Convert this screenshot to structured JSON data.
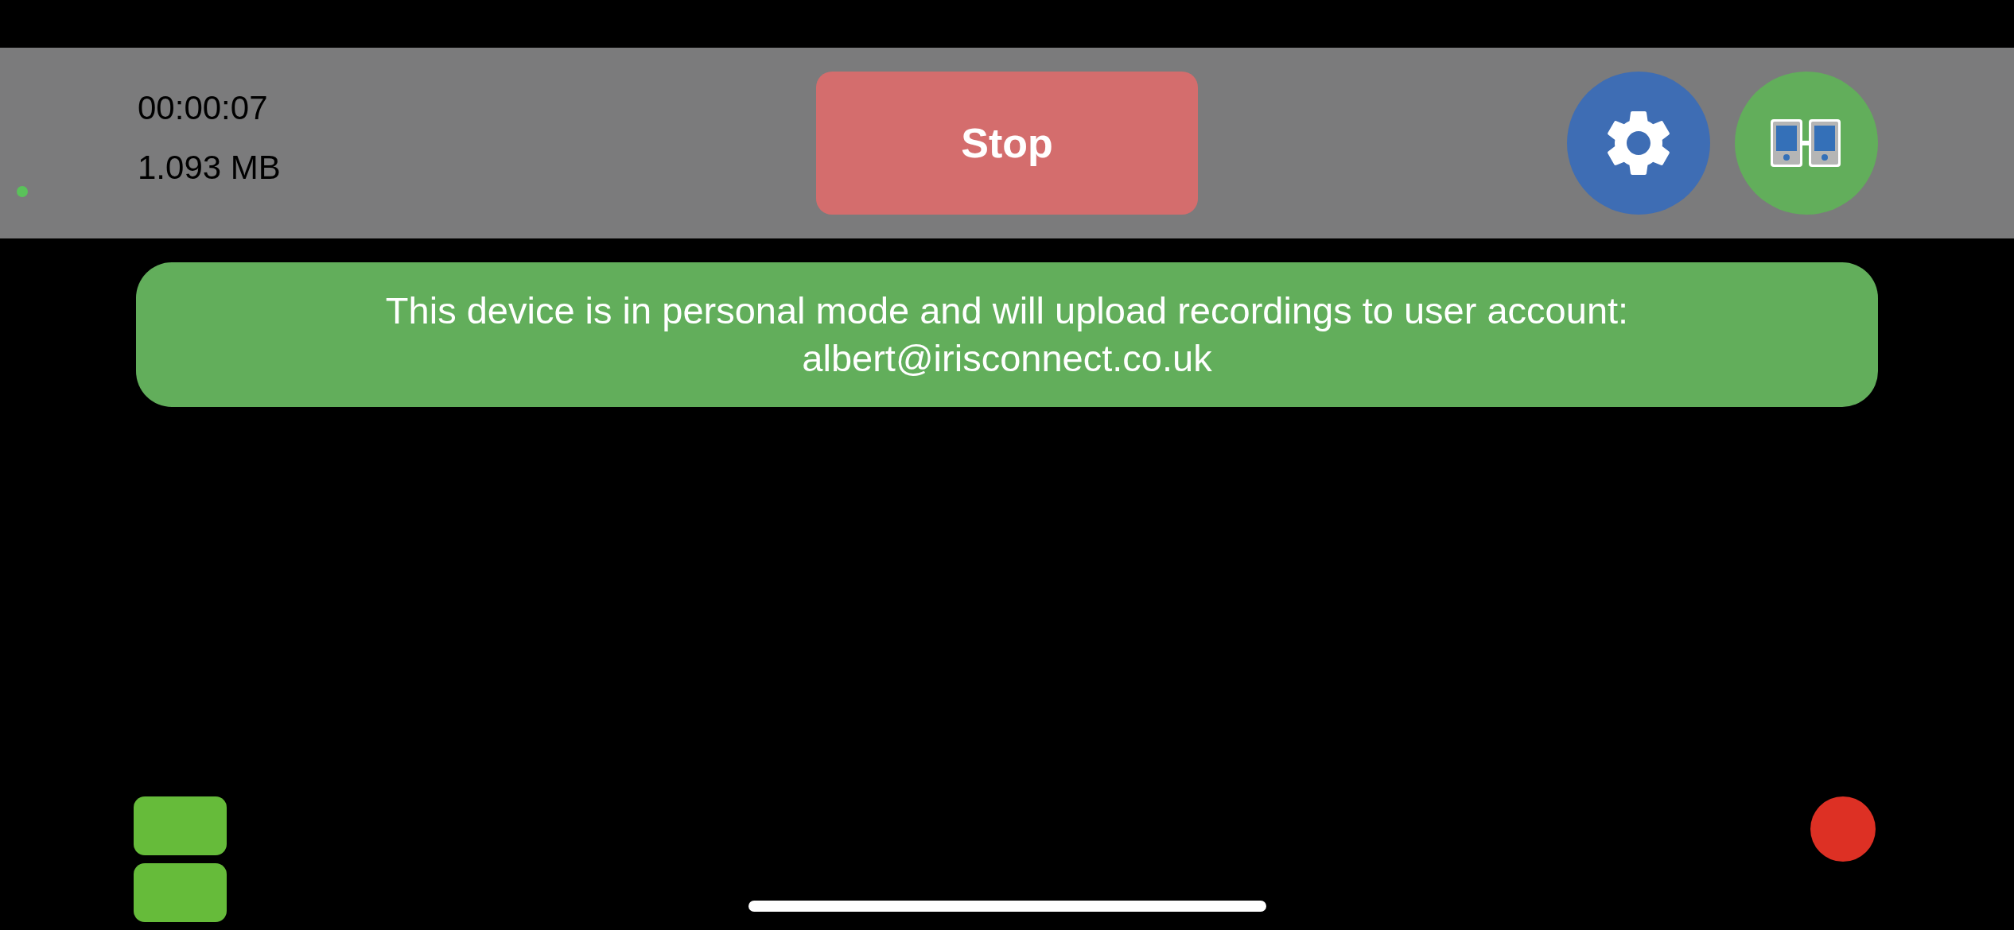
{
  "status": {
    "elapsed": "00:00:07",
    "size": "1.093 MB"
  },
  "stop_button": {
    "label": "Stop"
  },
  "banner": {
    "lines": [
      "This device is in personal mode and will upload recordings to user account:",
      "albert@irisconnect.co.uk"
    ]
  }
}
